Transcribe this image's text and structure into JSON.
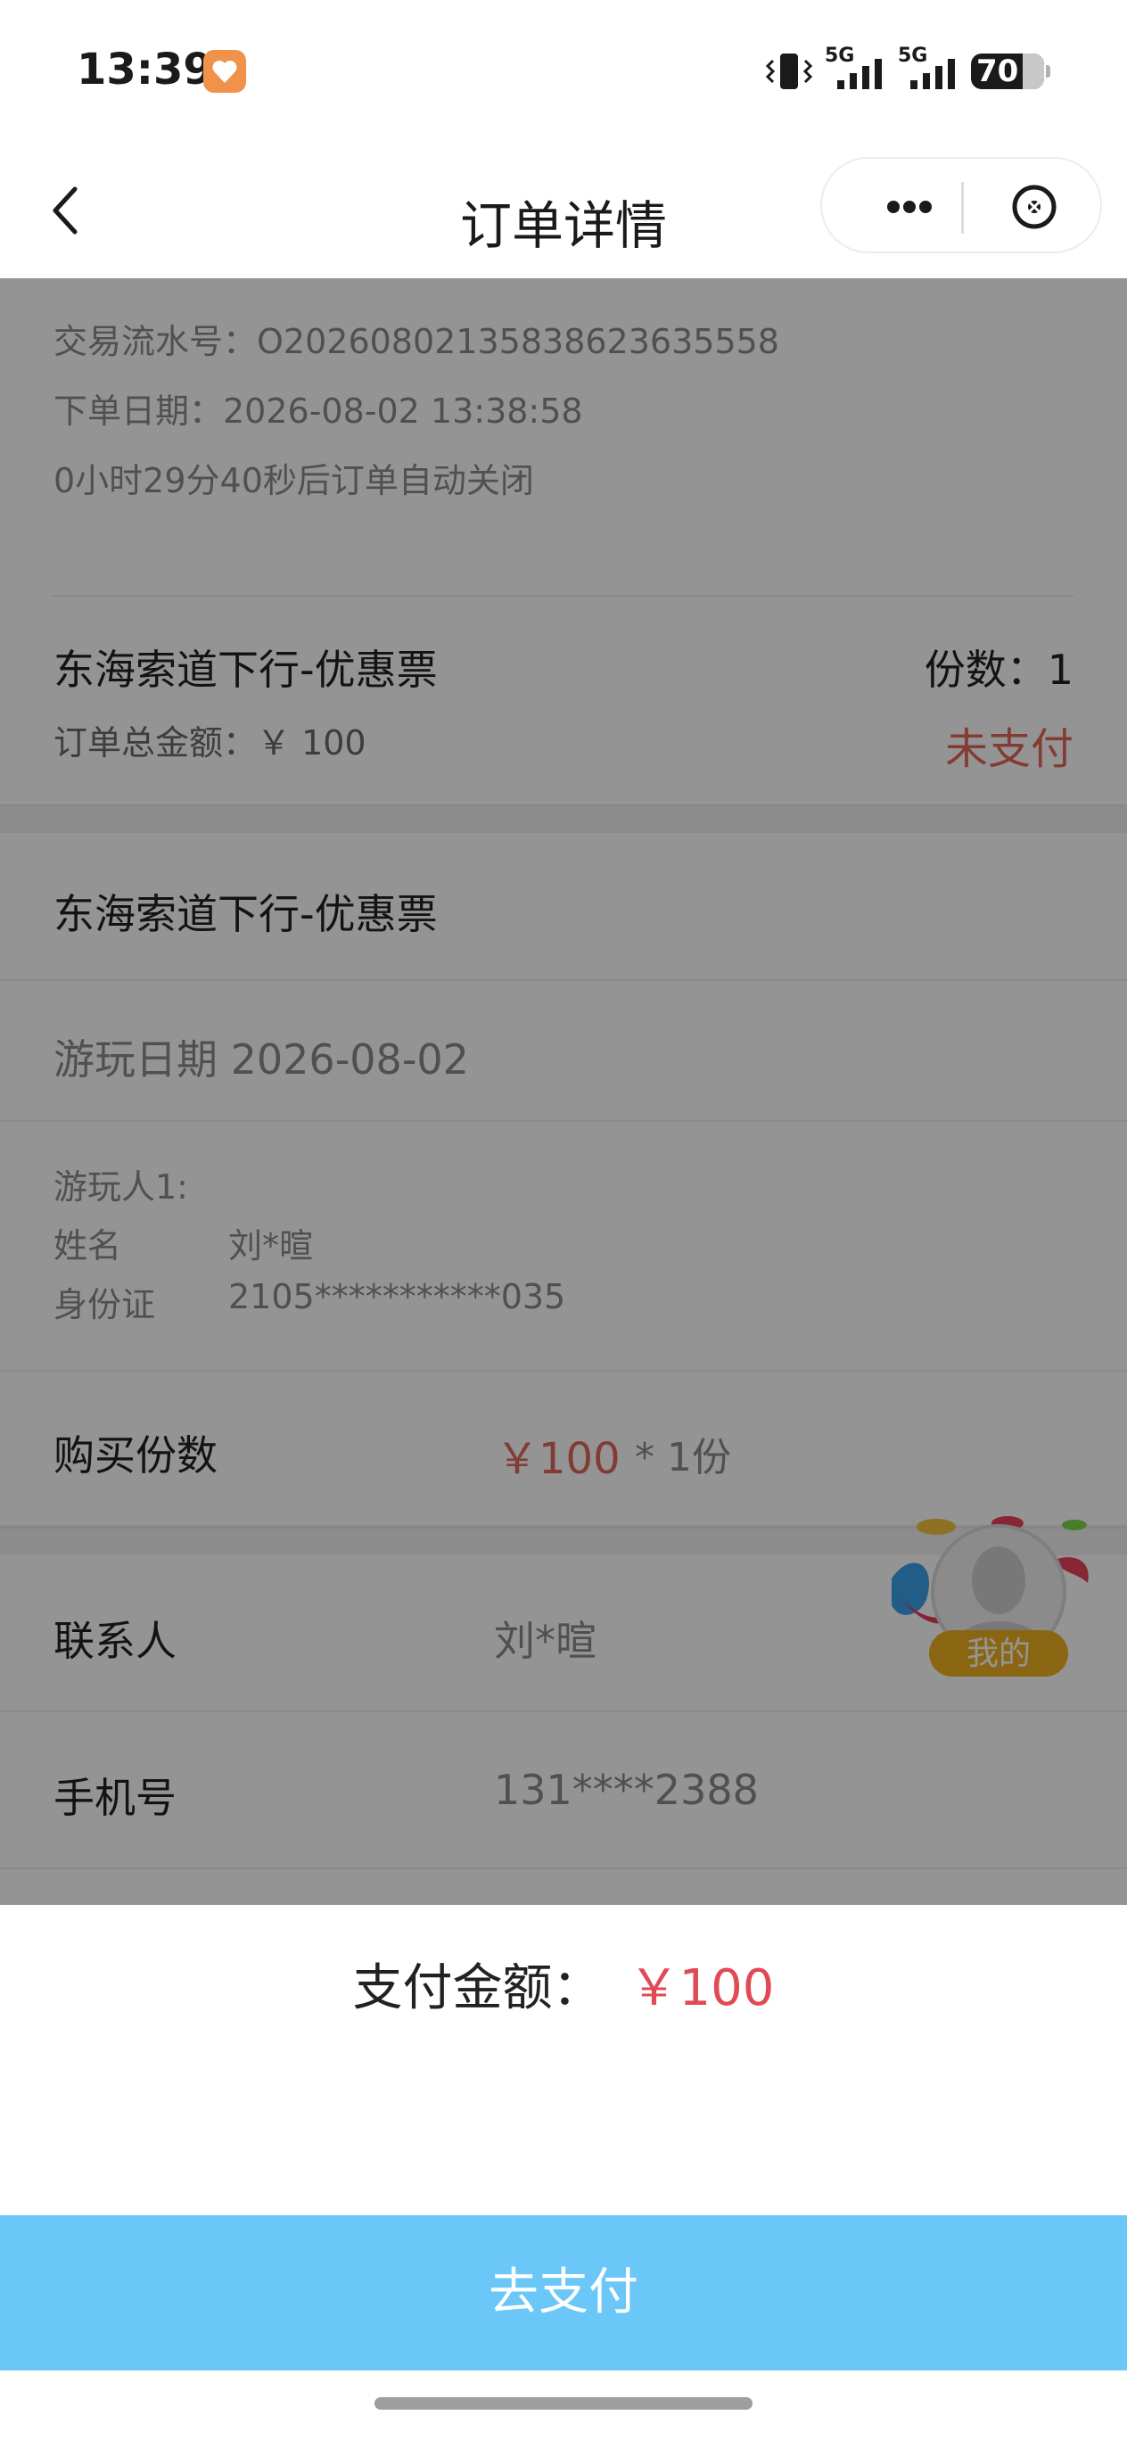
{
  "status_bar": {
    "time": "13:39",
    "network_1": "5G",
    "network_2": "5G",
    "battery": "70"
  },
  "nav": {
    "title": "订单详情"
  },
  "order": {
    "serial_line": "交易流水号：O20260802135838623635558",
    "date_line": "下单日期：2026-08-02 13:38:58",
    "countdown_line": "0小时29分40秒后订单自动关闭",
    "ticket_name": "东海索道下行-优惠票",
    "quantity": "份数：1",
    "total": "订单总金额：￥ 100",
    "status": "未支付"
  },
  "detail": {
    "ticket_name": "东海索道下行-优惠票",
    "visit_date": "游玩日期 2026-08-02",
    "visitor_title": "游玩人1:",
    "name_label": "姓名",
    "name_value": "刘*暄",
    "id_label": "身份证",
    "id_value": "2105***********035",
    "purchase_label": "购买份数",
    "price": "￥100",
    "times": "* 1份"
  },
  "contact": {
    "contact_label": "联系人",
    "contact_value": "刘*暄",
    "phone_label": "手机号",
    "phone_value": "131****2388"
  },
  "floating": {
    "label": "我的"
  },
  "payment": {
    "label": "支付金额：",
    "amount": "￥100",
    "button": "去支付"
  },
  "colors": {
    "accent_red": "#e04a55",
    "pay_button": "#6ac7f7",
    "overlay": "rgba(0,0,0,0.42)"
  }
}
